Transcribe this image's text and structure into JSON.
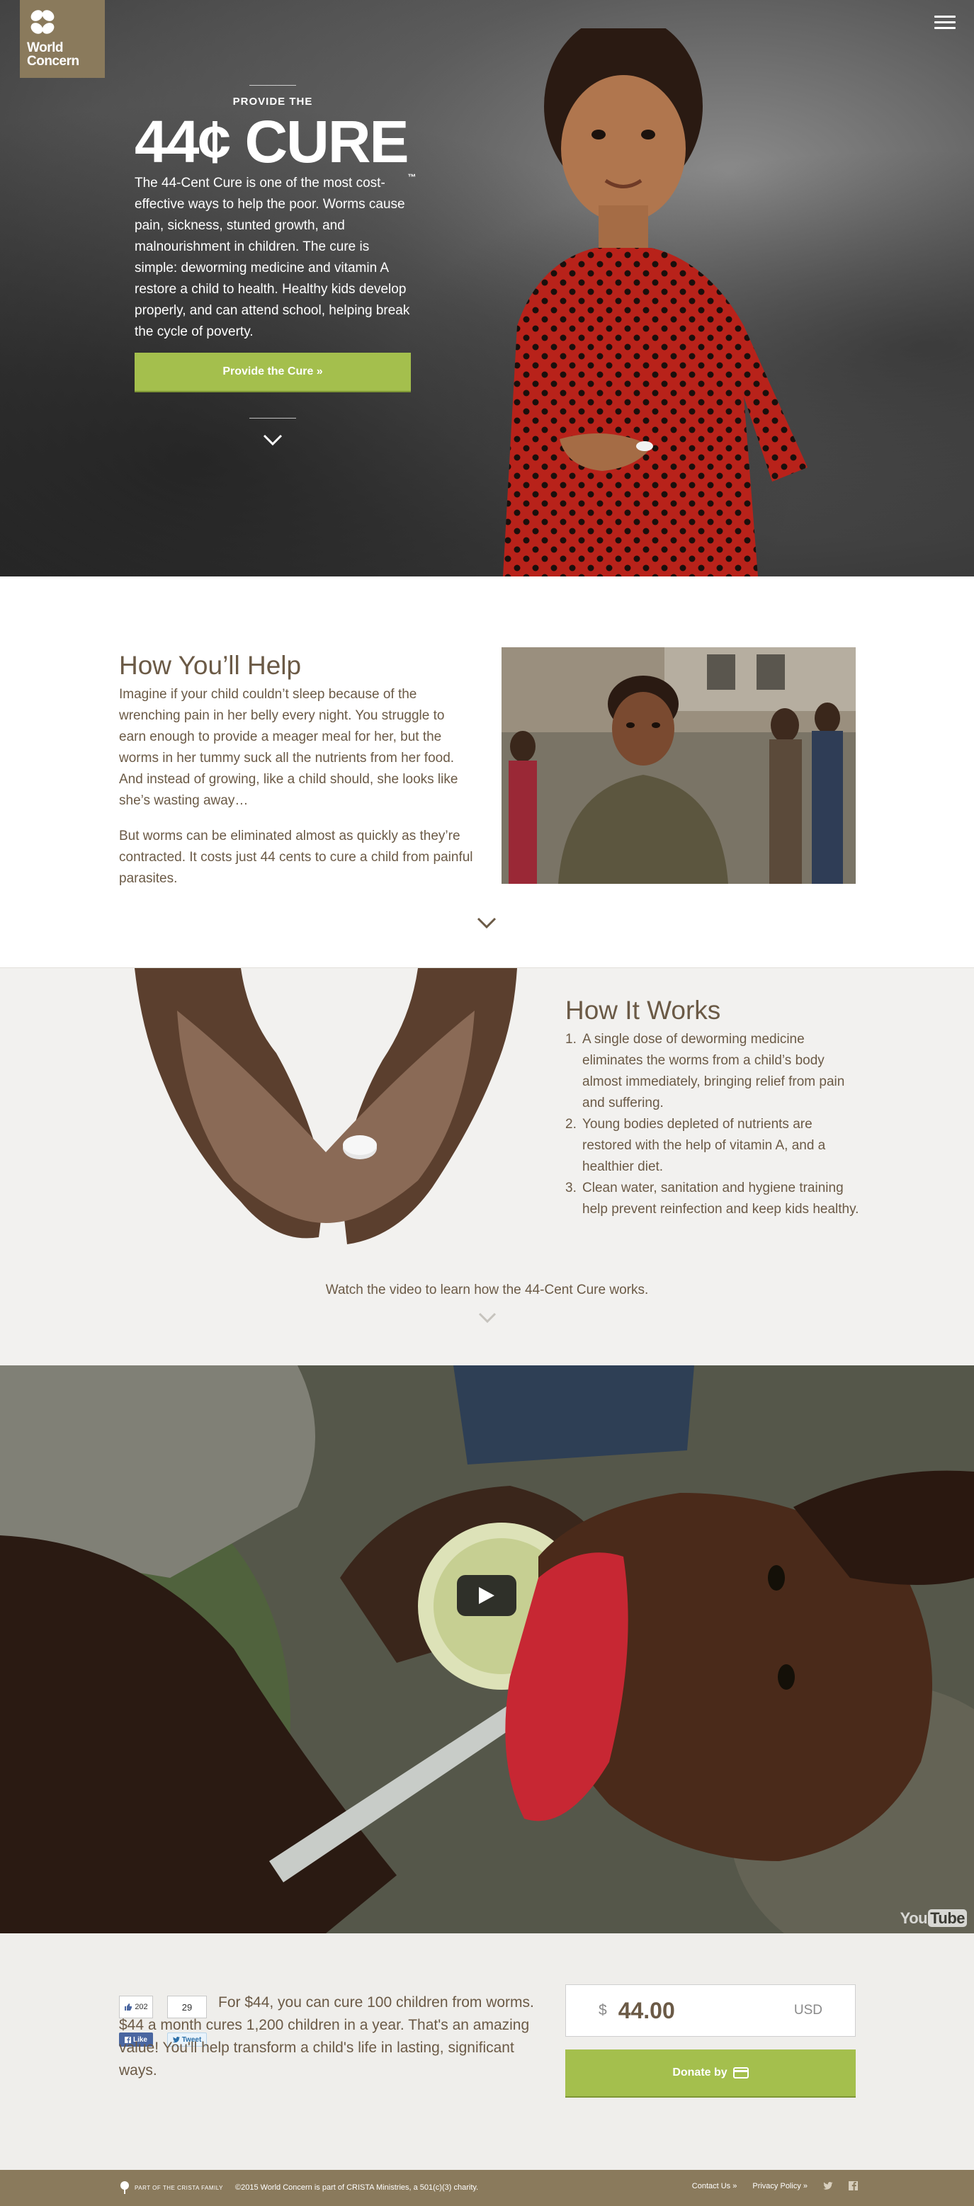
{
  "brand": {
    "name_line1": "World",
    "name_line2": "Concern"
  },
  "hero": {
    "kicker": "PROVIDE THE",
    "title": "44¢ CURE",
    "trademark": "™",
    "body": "The 44-Cent Cure is one of the most cost-effective ways to help the poor. Worms cause pain, sickness, stunted growth, and malnourishment in children. The cure is simple: deworming medicine and vitamin A restore a child to health. Healthy kids develop properly, and can attend school, helping break the cycle of poverty.",
    "cta_label": "Provide the Cure »"
  },
  "help": {
    "heading": "How You’ll Help",
    "paragraph1": "Imagine if your child couldn’t sleep because of the wrenching pain in her belly every night. You struggle to earn enough to provide a meager meal for her, but the worms in her tummy suck all the nutrients from her food. And instead of growing, like a child should, she looks like she’s wasting away…",
    "paragraph2": "But worms can be eliminated almost as quickly as they’re contracted. It costs just 44 cents to cure a child from painful parasites."
  },
  "works": {
    "heading": "How It Works",
    "steps": [
      "A single dose of deworming medicine eliminates the worms from a child’s body almost immediately, bringing relief from pain and suffering.",
      "Young bodies depleted of nutrients are restored with the help of vitamin A, and a healthier diet.",
      "Clean water, sanitation and hygiene training help prevent reinfection and keep kids healthy."
    ],
    "video_note": "Watch the video to learn how the 44-Cent Cure works."
  },
  "video": {
    "watermark_you": "You",
    "watermark_tube": "Tube"
  },
  "donate": {
    "fb_count": "202",
    "tw_count": "29",
    "fb_label": "Like",
    "tw_label": "Tweet",
    "text": "For $44, you can cure 100 children from worms. $44 a month cures 1,200 children in a year. That's an amazing value! You'll help transform a child's life in lasting, significant ways.",
    "currency_symbol": "$",
    "amount": "44.00",
    "currency": "USD",
    "button_label": "Donate by"
  },
  "footer": {
    "crista": "PART OF THE CRISTA FAMILY",
    "copyright": "©2015 World Concern is part of CRISTA Ministries, a 501(c)(3) charity.",
    "contact": "Contact Us »",
    "privacy": "Privacy Policy »"
  },
  "colors": {
    "brand_tan": "#8a7a5c",
    "accent_green": "#a4bf4d",
    "text_brown": "#6b5a46",
    "section_gray": "#f2f1ef"
  },
  "icons": [
    "logo-flower-icon",
    "menu-icon",
    "chevron-down-icon",
    "play-icon",
    "facebook-icon",
    "twitter-icon",
    "credit-card-icon"
  ]
}
